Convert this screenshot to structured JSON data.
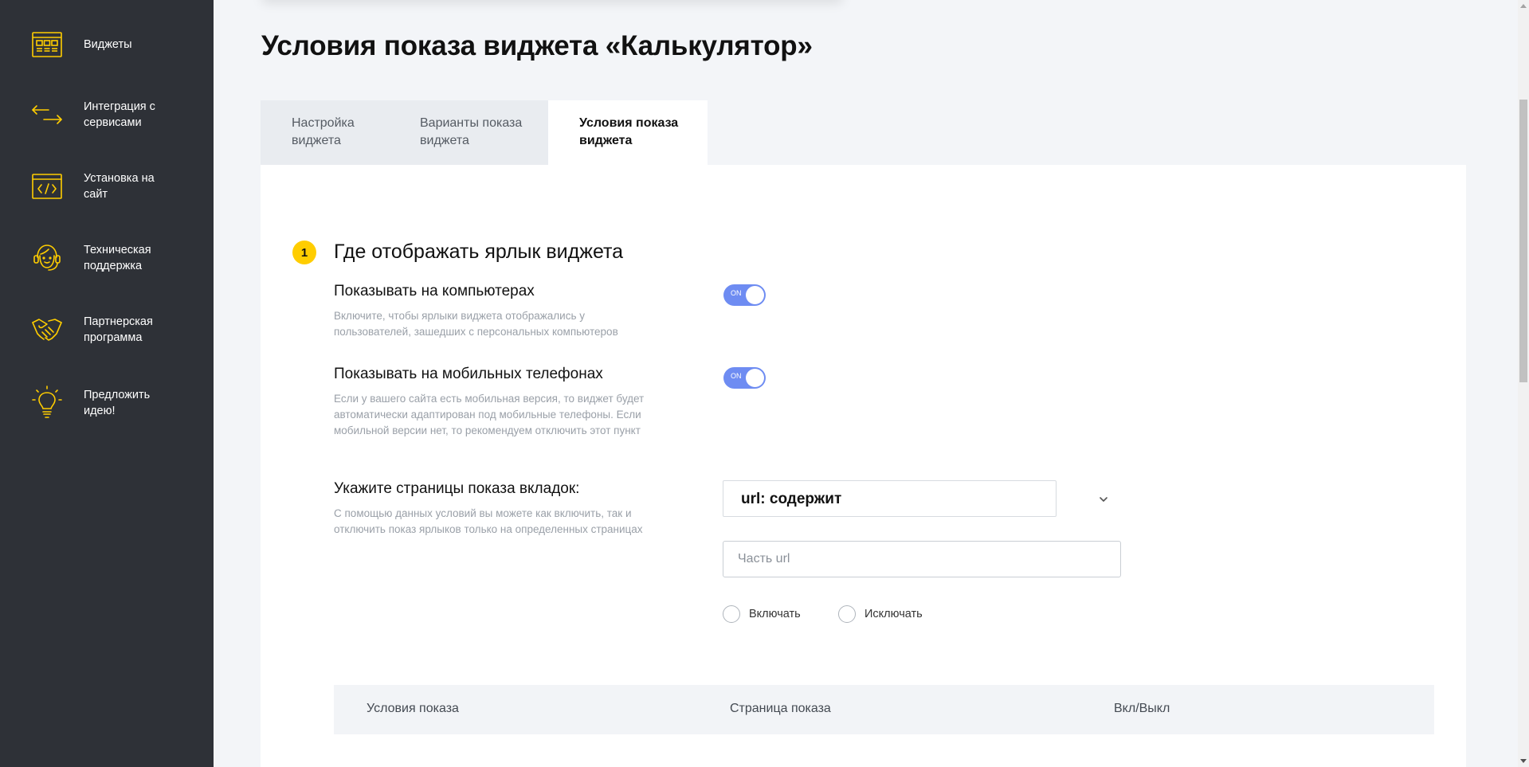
{
  "sidebar": {
    "items": [
      {
        "label": "Виджеты",
        "icon": "widgets-icon"
      },
      {
        "label": "Интеграция с сервисами",
        "icon": "integration-arrows-icon"
      },
      {
        "label": "Установка на сайт",
        "icon": "code-icon"
      },
      {
        "label": "Техническая поддержка",
        "icon": "support-headset-icon"
      },
      {
        "label": "Партнерская программа",
        "icon": "handshake-icon"
      },
      {
        "label": "Предложить идею!",
        "icon": "lightbulb-icon"
      }
    ],
    "icon_color": "#ffcd00"
  },
  "page": {
    "title": "Условия показа виджета «Калькулятор»"
  },
  "tabs": [
    {
      "label": "Настройка виджета",
      "active": false
    },
    {
      "label": "Варианты показа виджета",
      "active": false
    },
    {
      "label": "Условия показа виджета",
      "active": true
    }
  ],
  "section": {
    "number": "1",
    "title": "Где отображать ярлык виджета"
  },
  "options": {
    "desktop": {
      "title": "Показывать на компьютерах",
      "description": "Включите, чтобы ярлыки виджета отображались у пользователей, зашедших с персональных компьютеров",
      "toggle_label": "ON",
      "enabled": true
    },
    "mobile": {
      "title": "Показывать на мобильных телефонах",
      "description": "Если у вашего сайта есть мобильная версия, то виджет будет автоматически адаптирован под мобильные телефоны. Если мобильной версии нет, то рекомендуем отключить этот пункт",
      "toggle_label": "ON",
      "enabled": true
    },
    "pages": {
      "title": "Укажите страницы показа вкладок:",
      "description": "С помощью данных условий вы можете как включить, так и отключить показ ярлыков только на определенных страницах",
      "select_value": "url: содержит",
      "input_placeholder": "Часть url",
      "input_value": "",
      "radio_include": "Включать",
      "radio_exclude": "Исключать"
    }
  },
  "table": {
    "headers": [
      "Условия показа",
      "Страница показа",
      "Вкл/Выкл"
    ]
  },
  "colors": {
    "sidebar_bg": "#2e3137",
    "accent_yellow": "#ffcd00",
    "toggle_on": "#6e8cf2"
  }
}
